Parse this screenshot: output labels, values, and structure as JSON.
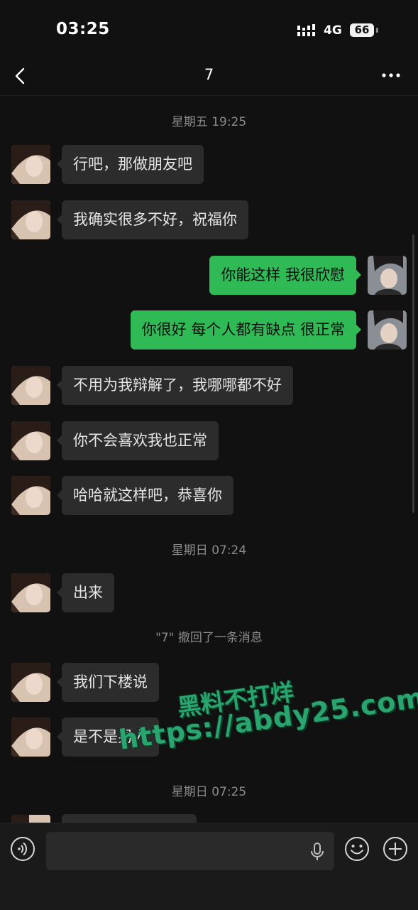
{
  "status_bar": {
    "time": "03:25",
    "network": "4G",
    "battery": "66"
  },
  "nav": {
    "title": "7"
  },
  "messages": [
    {
      "kind": "time",
      "text": "星期五 19:25"
    },
    {
      "kind": "in",
      "text": "行吧，那做朋友吧"
    },
    {
      "kind": "in",
      "text": "我确实很多不好，祝福你"
    },
    {
      "kind": "out",
      "text": "你能这样 我很欣慰"
    },
    {
      "kind": "out",
      "text": "你很好 每个人都有缺点 很正常"
    },
    {
      "kind": "in",
      "text": "不用为我辩解了，我哪哪都不好"
    },
    {
      "kind": "in",
      "text": "你不会喜欢我也正常"
    },
    {
      "kind": "in",
      "text": "哈哈就这样吧，恭喜你"
    },
    {
      "kind": "time",
      "text": "星期日 07:24"
    },
    {
      "kind": "in",
      "text": "出来"
    },
    {
      "kind": "system",
      "text": "\"7\" 撤回了一条消息"
    },
    {
      "kind": "in",
      "text": "我们下楼说"
    },
    {
      "kind": "in",
      "text": "是不是男人"
    },
    {
      "kind": "time",
      "text": "星期日 07:25"
    }
  ],
  "watermark": {
    "line1": "黑料不打烊",
    "line2": "https://abdy25.com"
  },
  "icons": {
    "back": "chevron-left-icon",
    "more": "more-dots-icon",
    "voice": "voice-toggle-icon",
    "mic": "microphone-icon",
    "emoji": "emoji-icon",
    "plus": "plus-circle-icon"
  },
  "colors": {
    "outgoing_bubble": "#2fba55",
    "incoming_bubble": "#2c2c2c",
    "background": "#111111"
  }
}
